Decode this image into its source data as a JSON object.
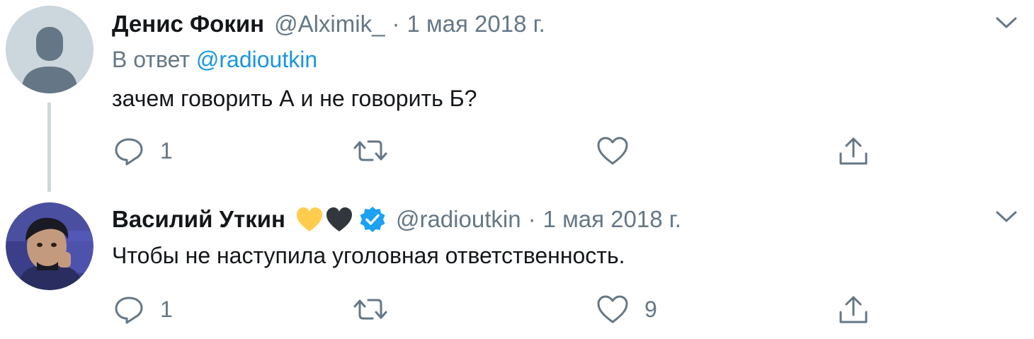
{
  "tweets": [
    {
      "author_name": "Денис Фокин",
      "handle": "@Alximik_",
      "separator": "·",
      "date": "1 мая 2018 г.",
      "reply_prefix": "В ответ",
      "reply_to": "@radioutkin",
      "text": "зачем говорить А и не говорить Б?",
      "reply_count": "1",
      "retweet_count": "",
      "like_count": "",
      "avatar_icon": "default-profile-icon"
    },
    {
      "author_name": "Василий Уткин",
      "name_emoji": [
        "yellow-heart-icon",
        "black-heart-icon"
      ],
      "verified": true,
      "handle": "@radioutkin",
      "separator": "·",
      "date": "1 мая 2018 г.",
      "text": "Чтобы не наступила уголовная ответственность.",
      "reply_count": "1",
      "retweet_count": "",
      "like_count": "9",
      "avatar_icon": "profile-photo"
    }
  ],
  "colors": {
    "text": "#14171a",
    "muted": "#657786",
    "link": "#1b95e0",
    "verified": "#1da1f2",
    "thread_line": "#ccd6dd",
    "yellow_heart": "#ffcc4d",
    "black_heart": "#31373d"
  }
}
